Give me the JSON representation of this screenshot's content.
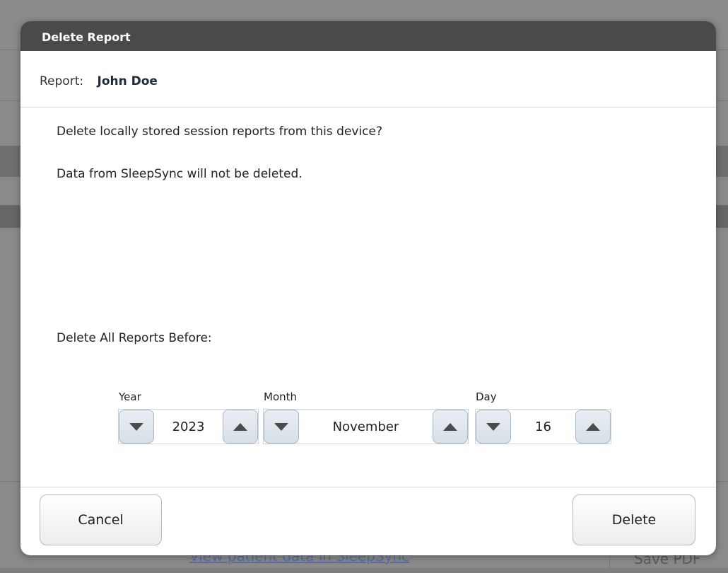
{
  "background": {
    "link_text": "View patient data in SleepSync",
    "save_pdf_label": "Save PDF"
  },
  "dialog": {
    "title": "Delete Report",
    "report_label": "Report:",
    "report_name": "John Doe",
    "message_line1": "Delete locally stored session reports from this device?",
    "message_line2": "Data from SleepSync will not be deleted.",
    "date_prompt": "Delete All Reports Before:",
    "year": {
      "label": "Year",
      "value": "2023"
    },
    "month": {
      "label": "Month",
      "value": "November"
    },
    "day": {
      "label": "Day",
      "value": "16"
    },
    "cancel_label": "Cancel",
    "delete_label": "Delete"
  },
  "colors": {
    "title_bar": "#4a4a4a",
    "overlay": "#7e7e7e",
    "spinner_button": "#dfe6ed"
  }
}
